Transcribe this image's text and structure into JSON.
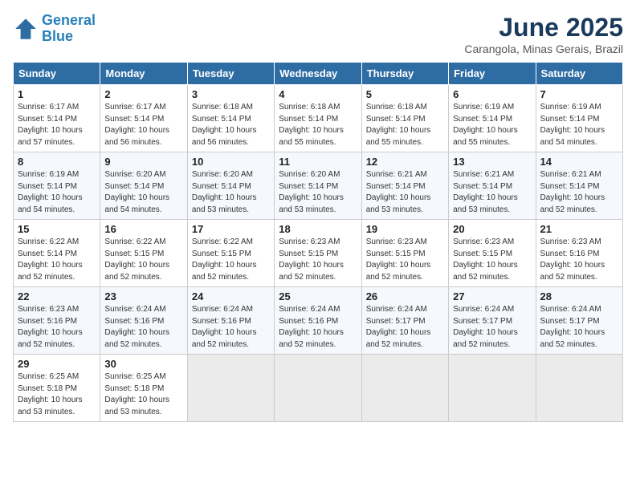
{
  "logo": {
    "line1": "General",
    "line2": "Blue"
  },
  "title": "June 2025",
  "subtitle": "Carangola, Minas Gerais, Brazil",
  "days_of_week": [
    "Sunday",
    "Monday",
    "Tuesday",
    "Wednesday",
    "Thursday",
    "Friday",
    "Saturday"
  ],
  "weeks": [
    [
      {
        "day": "1",
        "info": "Sunrise: 6:17 AM\nSunset: 5:14 PM\nDaylight: 10 hours\nand 57 minutes."
      },
      {
        "day": "2",
        "info": "Sunrise: 6:17 AM\nSunset: 5:14 PM\nDaylight: 10 hours\nand 56 minutes."
      },
      {
        "day": "3",
        "info": "Sunrise: 6:18 AM\nSunset: 5:14 PM\nDaylight: 10 hours\nand 56 minutes."
      },
      {
        "day": "4",
        "info": "Sunrise: 6:18 AM\nSunset: 5:14 PM\nDaylight: 10 hours\nand 55 minutes."
      },
      {
        "day": "5",
        "info": "Sunrise: 6:18 AM\nSunset: 5:14 PM\nDaylight: 10 hours\nand 55 minutes."
      },
      {
        "day": "6",
        "info": "Sunrise: 6:19 AM\nSunset: 5:14 PM\nDaylight: 10 hours\nand 55 minutes."
      },
      {
        "day": "7",
        "info": "Sunrise: 6:19 AM\nSunset: 5:14 PM\nDaylight: 10 hours\nand 54 minutes."
      }
    ],
    [
      {
        "day": "8",
        "info": "Sunrise: 6:19 AM\nSunset: 5:14 PM\nDaylight: 10 hours\nand 54 minutes."
      },
      {
        "day": "9",
        "info": "Sunrise: 6:20 AM\nSunset: 5:14 PM\nDaylight: 10 hours\nand 54 minutes."
      },
      {
        "day": "10",
        "info": "Sunrise: 6:20 AM\nSunset: 5:14 PM\nDaylight: 10 hours\nand 53 minutes."
      },
      {
        "day": "11",
        "info": "Sunrise: 6:20 AM\nSunset: 5:14 PM\nDaylight: 10 hours\nand 53 minutes."
      },
      {
        "day": "12",
        "info": "Sunrise: 6:21 AM\nSunset: 5:14 PM\nDaylight: 10 hours\nand 53 minutes."
      },
      {
        "day": "13",
        "info": "Sunrise: 6:21 AM\nSunset: 5:14 PM\nDaylight: 10 hours\nand 53 minutes."
      },
      {
        "day": "14",
        "info": "Sunrise: 6:21 AM\nSunset: 5:14 PM\nDaylight: 10 hours\nand 52 minutes."
      }
    ],
    [
      {
        "day": "15",
        "info": "Sunrise: 6:22 AM\nSunset: 5:14 PM\nDaylight: 10 hours\nand 52 minutes."
      },
      {
        "day": "16",
        "info": "Sunrise: 6:22 AM\nSunset: 5:15 PM\nDaylight: 10 hours\nand 52 minutes."
      },
      {
        "day": "17",
        "info": "Sunrise: 6:22 AM\nSunset: 5:15 PM\nDaylight: 10 hours\nand 52 minutes."
      },
      {
        "day": "18",
        "info": "Sunrise: 6:23 AM\nSunset: 5:15 PM\nDaylight: 10 hours\nand 52 minutes."
      },
      {
        "day": "19",
        "info": "Sunrise: 6:23 AM\nSunset: 5:15 PM\nDaylight: 10 hours\nand 52 minutes."
      },
      {
        "day": "20",
        "info": "Sunrise: 6:23 AM\nSunset: 5:15 PM\nDaylight: 10 hours\nand 52 minutes."
      },
      {
        "day": "21",
        "info": "Sunrise: 6:23 AM\nSunset: 5:16 PM\nDaylight: 10 hours\nand 52 minutes."
      }
    ],
    [
      {
        "day": "22",
        "info": "Sunrise: 6:23 AM\nSunset: 5:16 PM\nDaylight: 10 hours\nand 52 minutes."
      },
      {
        "day": "23",
        "info": "Sunrise: 6:24 AM\nSunset: 5:16 PM\nDaylight: 10 hours\nand 52 minutes."
      },
      {
        "day": "24",
        "info": "Sunrise: 6:24 AM\nSunset: 5:16 PM\nDaylight: 10 hours\nand 52 minutes."
      },
      {
        "day": "25",
        "info": "Sunrise: 6:24 AM\nSunset: 5:16 PM\nDaylight: 10 hours\nand 52 minutes."
      },
      {
        "day": "26",
        "info": "Sunrise: 6:24 AM\nSunset: 5:17 PM\nDaylight: 10 hours\nand 52 minutes."
      },
      {
        "day": "27",
        "info": "Sunrise: 6:24 AM\nSunset: 5:17 PM\nDaylight: 10 hours\nand 52 minutes."
      },
      {
        "day": "28",
        "info": "Sunrise: 6:24 AM\nSunset: 5:17 PM\nDaylight: 10 hours\nand 52 minutes."
      }
    ],
    [
      {
        "day": "29",
        "info": "Sunrise: 6:25 AM\nSunset: 5:18 PM\nDaylight: 10 hours\nand 53 minutes."
      },
      {
        "day": "30",
        "info": "Sunrise: 6:25 AM\nSunset: 5:18 PM\nDaylight: 10 hours\nand 53 minutes."
      },
      {
        "day": "",
        "info": ""
      },
      {
        "day": "",
        "info": ""
      },
      {
        "day": "",
        "info": ""
      },
      {
        "day": "",
        "info": ""
      },
      {
        "day": "",
        "info": ""
      }
    ]
  ]
}
